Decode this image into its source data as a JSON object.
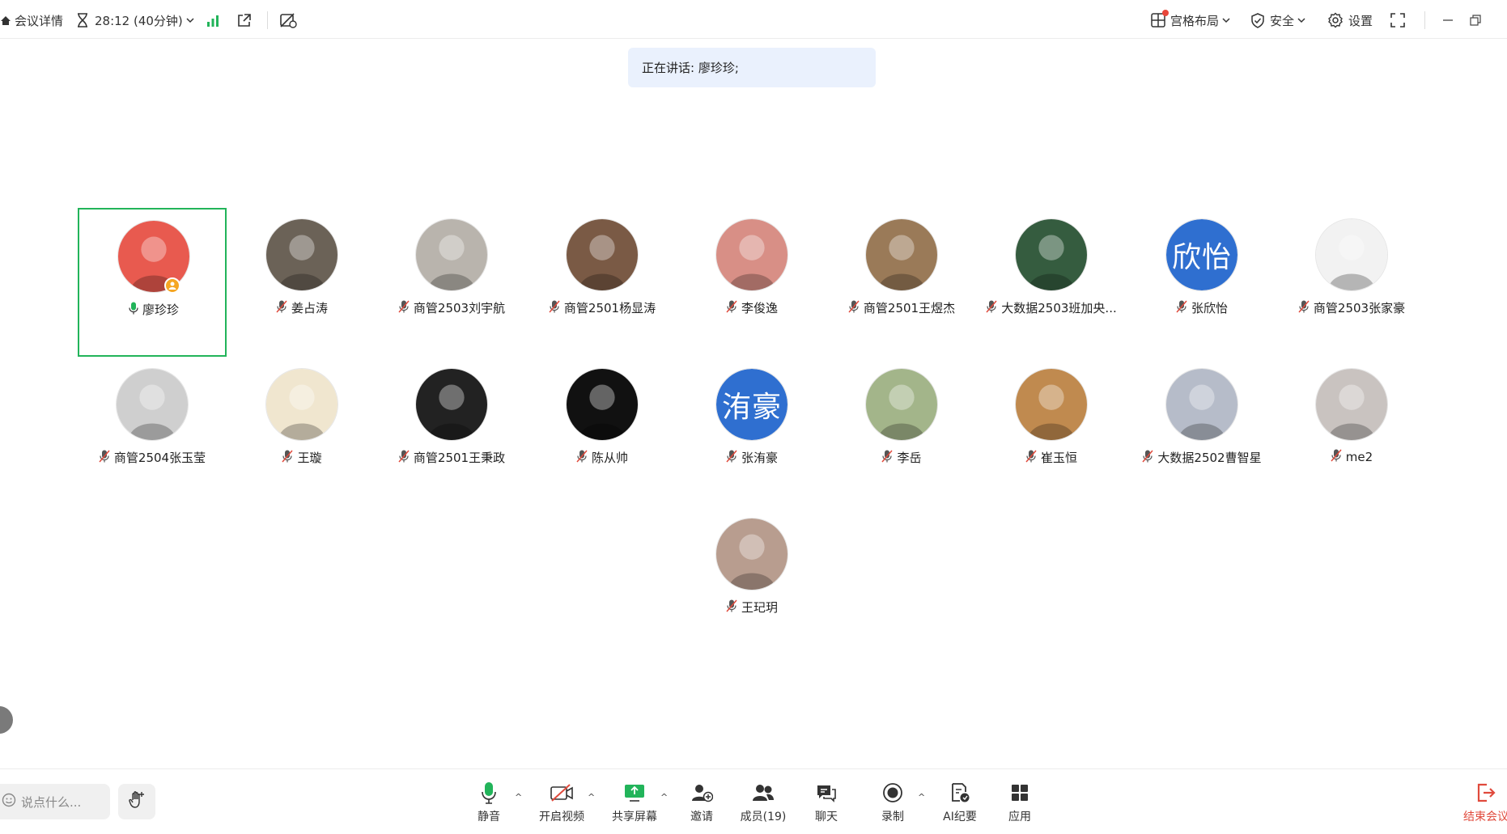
{
  "topbar": {
    "meeting_details": "会议详情",
    "timer": "28:12 (40分钟)",
    "layout": "宫格布局",
    "security": "安全",
    "settings": "设置"
  },
  "speaking": "正在讲话: 廖珍珍;",
  "participants": [
    {
      "name": "廖珍珍",
      "mic": "on",
      "host": true,
      "active": true
    },
    {
      "name": "姜占涛",
      "mic": "off"
    },
    {
      "name": "商管2503刘宇航",
      "mic": "off"
    },
    {
      "name": "商管2501杨显涛",
      "mic": "off"
    },
    {
      "name": "李俊逸",
      "mic": "off"
    },
    {
      "name": "商管2501王煜杰",
      "mic": "off"
    },
    {
      "name": "大数据2503班加央...",
      "mic": "off"
    },
    {
      "name": "张欣怡",
      "mic": "off",
      "avatar_text": "欣怡"
    },
    {
      "name": "商管2503张家豪",
      "mic": "off"
    },
    {
      "name": "商管2504张玉莹",
      "mic": "off"
    },
    {
      "name": "王璇",
      "mic": "off"
    },
    {
      "name": "商管2501王秉政",
      "mic": "off"
    },
    {
      "name": "陈从帅",
      "mic": "off"
    },
    {
      "name": "张洧豪",
      "mic": "off",
      "avatar_text": "洧豪"
    },
    {
      "name": "李岳",
      "mic": "off"
    },
    {
      "name": "崔玉恒",
      "mic": "off"
    },
    {
      "name": "大数据2502曹智星",
      "mic": "off"
    },
    {
      "name": "me2",
      "mic": "off"
    },
    {
      "name": "王玘玥",
      "mic": "off"
    }
  ],
  "bottombar": {
    "chat_placeholder": "说点什么...",
    "mute": "静音",
    "video": "开启视频",
    "share": "共享屏幕",
    "invite": "邀请",
    "members": "成员(19)",
    "chat": "聊天",
    "record": "录制",
    "ai_summary": "AI纪要",
    "apps": "应用",
    "end": "结束会议"
  },
  "colors": {
    "accent_green": "#22b45a",
    "active_border": "#22b45a",
    "end_red": "#e04a3c",
    "banner_bg": "#eaf1fd",
    "avatar_blue": "#2f6fd0"
  }
}
